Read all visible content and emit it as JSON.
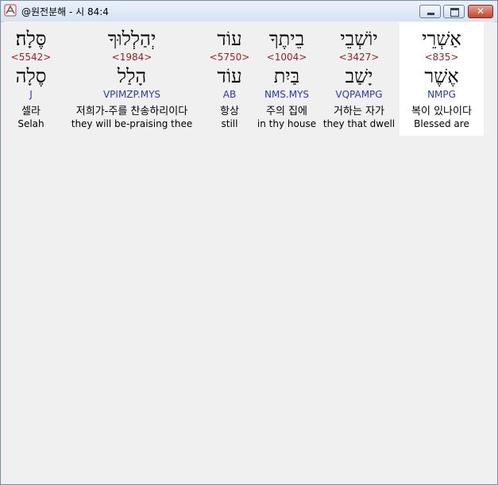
{
  "window": {
    "title": "@원전분해 - 시 84:4",
    "icon": "hebrew-tool-icon",
    "close_glyph": "✕"
  },
  "words": [
    {
      "hebrew": "אַשְׁרֵי",
      "strong": "<835>",
      "lemma": "אֶשֶׁר",
      "morph": "NMPG",
      "korean": "복이 있나이다",
      "english": "Blessed are",
      "selected": true
    },
    {
      "hebrew": "יוֹשְׁבֵי",
      "strong": "<3427>",
      "lemma": "יָשַׁב",
      "morph": "VQPAMPG",
      "korean": "거하는 자가",
      "english": "they that dwell",
      "selected": false
    },
    {
      "hebrew": "בֵיתֶךָ",
      "strong": "<1004>",
      "lemma": "בַּיִת",
      "morph": "NMS.MYS",
      "korean": "주의 집에",
      "english": "in thy house",
      "selected": false
    },
    {
      "hebrew": "עוֹד",
      "strong": "<5750>",
      "lemma": "עוֹד",
      "morph": "AB",
      "korean": "항상",
      "english": "still",
      "selected": false
    },
    {
      "hebrew": "יְהַלְלוּךָ",
      "strong": "<1984>",
      "lemma": "הָלַל",
      "morph": "VPIMZP.MYS",
      "korean": "저희가-주를 찬송하리이다",
      "english": "they will be-praising thee",
      "selected": false
    },
    {
      "hebrew": "סֶּלָה׃",
      "strong": "<5542>",
      "lemma": "סֶלָה",
      "morph": "J",
      "korean": "셀라",
      "english": "Selah",
      "selected": false
    }
  ]
}
